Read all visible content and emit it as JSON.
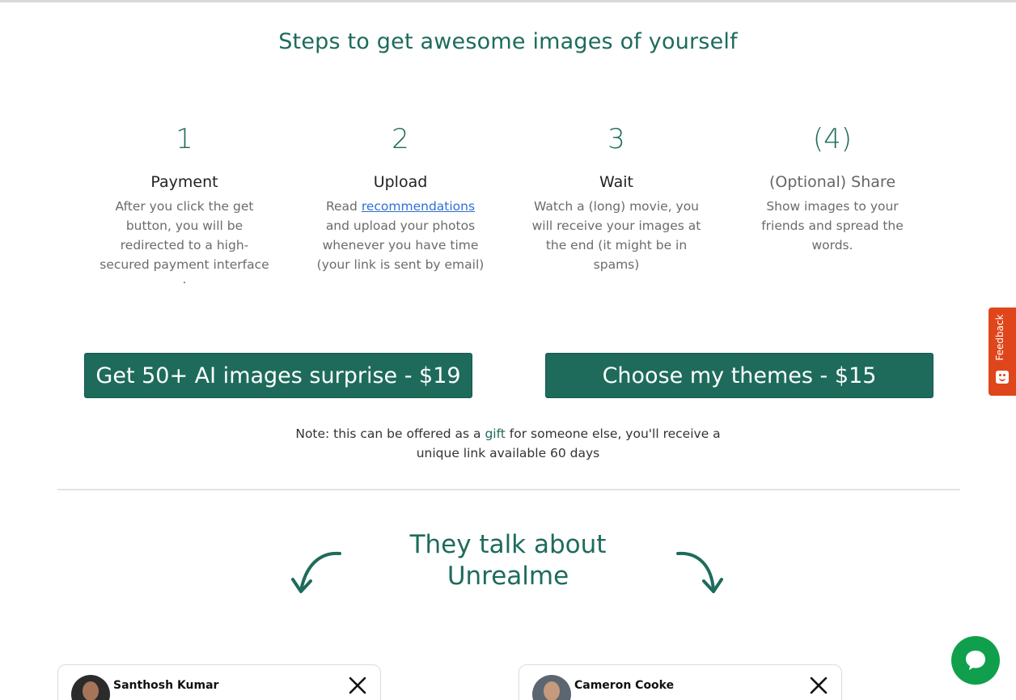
{
  "main": {
    "title": "Steps to get awesome images of yourself",
    "steps": [
      {
        "number": "1",
        "name": "Payment",
        "desc_lines": [
          "After you click the get",
          "button, you will be",
          "redirected to a high-",
          "secured payment interface",
          "."
        ]
      },
      {
        "number": "2",
        "name": "Upload",
        "desc_prefix": "Read",
        "desc_link": "recommendations",
        "desc_lines": [
          "and upload your photos",
          "whenever you have time",
          "(your link is sent by email)"
        ]
      },
      {
        "number": "3",
        "name": "Wait",
        "desc_lines": [
          "Watch a (long) movie, you",
          "will receive your images at",
          "the end (it might be in",
          "spams)"
        ]
      },
      {
        "number": "(4)",
        "name": "(Optional) Share",
        "desc_lines": [
          "Show images to your",
          "friends and spread the",
          "words."
        ]
      }
    ],
    "buttons": {
      "surprise": "Get 50+ AI images surprise - $19",
      "themes": "Choose my themes - $15"
    },
    "note": {
      "before": "Note: this can be offered as a",
      "gift": "gift",
      "after": "for someone else, you'll receive a",
      "line2": "unique link available 60 days"
    }
  },
  "testimonials": {
    "title_line1": "They talk about",
    "title_line2": "Unrealme",
    "cards": [
      {
        "name": "Santhosh Kumar"
      },
      {
        "name": "Cameron Cooke"
      }
    ]
  },
  "widgets": {
    "feedback_label": "Feedback"
  },
  "colors": {
    "brand": "#1e6b5c",
    "feedback": "#e0461b",
    "chat": "#10a04d",
    "link": "#2f6fd6"
  },
  "icons": [
    "arrow-curve-left-icon",
    "arrow-curve-right-icon",
    "x-logo-icon",
    "feedback-smile-icon",
    "chat-icon"
  ]
}
